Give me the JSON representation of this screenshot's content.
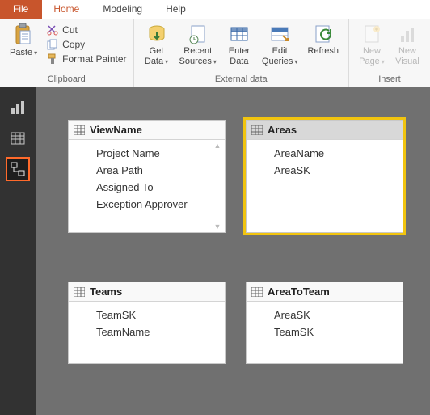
{
  "tabs": {
    "file": "File",
    "home": "Home",
    "modeling": "Modeling",
    "help": "Help"
  },
  "ribbon": {
    "clipboard": {
      "paste": "Paste",
      "cut": "Cut",
      "copy": "Copy",
      "format_painter": "Format Painter",
      "group": "Clipboard"
    },
    "external": {
      "get_data": "Get\nData",
      "recent_sources": "Recent\nSources",
      "enter_data": "Enter\nData",
      "edit_queries": "Edit\nQueries",
      "refresh": "Refresh",
      "group": "External data"
    },
    "insert": {
      "new_page": "New\nPage",
      "new_visual": "New\nVisual",
      "group": "Insert"
    }
  },
  "entities": {
    "viewName": {
      "title": "ViewName",
      "fields": [
        "Project Name",
        "Area Path",
        "Assigned To",
        "Exception Approver"
      ]
    },
    "areas": {
      "title": "Areas",
      "fields": [
        "AreaName",
        "AreaSK"
      ]
    },
    "teams": {
      "title": "Teams",
      "fields": [
        "TeamSK",
        "TeamName"
      ]
    },
    "areaToTeam": {
      "title": "AreaToTeam",
      "fields": [
        "AreaSK",
        "TeamSK"
      ]
    }
  }
}
